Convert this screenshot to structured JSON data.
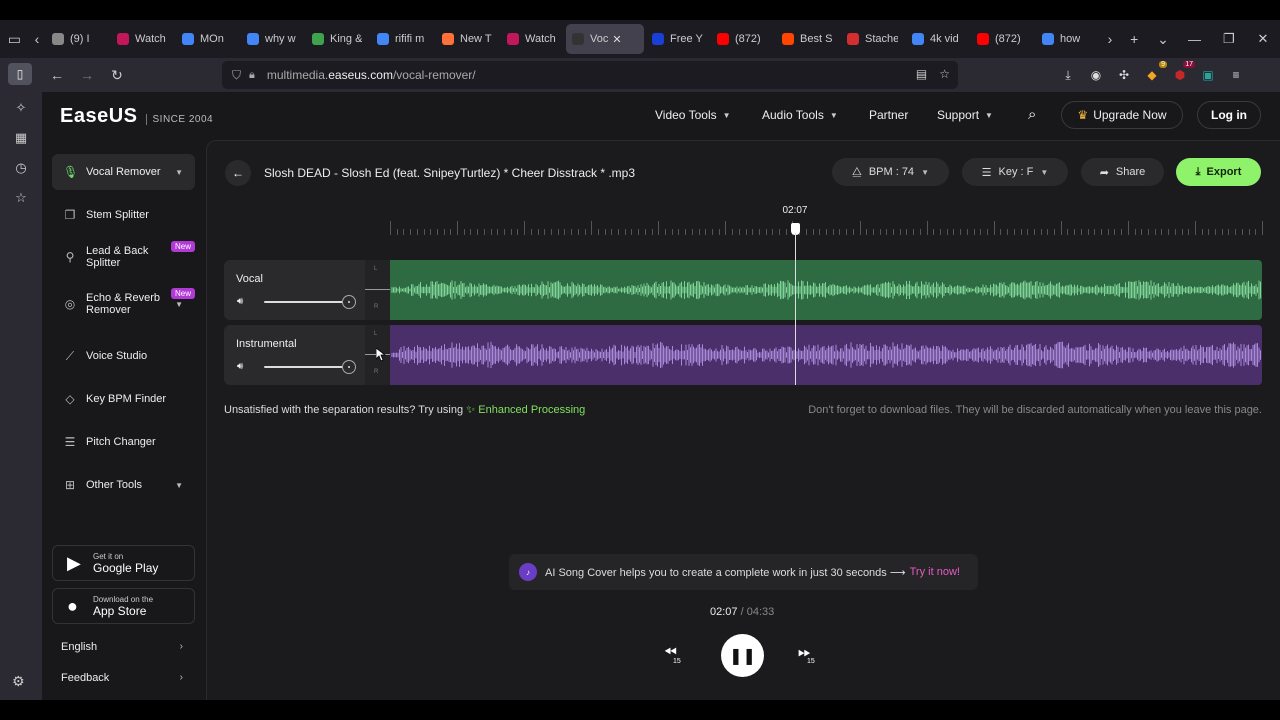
{
  "browser": {
    "tabs": [
      {
        "title": "(9) I",
        "favicon_color": "#888888",
        "icon": "generic-icon"
      },
      {
        "title": "Watch",
        "favicon_color": "#c2185b",
        "icon": "video-icon"
      },
      {
        "title": "MOn",
        "favicon_color": "#4285f4",
        "icon": "google-icon"
      },
      {
        "title": "why w",
        "favicon_color": "#4285f4",
        "icon": "google-icon"
      },
      {
        "title": "King &",
        "favicon_color": "#3fa34d",
        "icon": "leaf-icon"
      },
      {
        "title": "rififi m",
        "favicon_color": "#4285f4",
        "icon": "google-icon"
      },
      {
        "title": "New T",
        "favicon_color": "#ff7139",
        "icon": "firefox-icon"
      },
      {
        "title": "Watch",
        "favicon_color": "#c2185b",
        "icon": "video-icon"
      },
      {
        "title": "Voc",
        "favicon_color": "#333333",
        "icon": "audio-icon",
        "active": true
      },
      {
        "title": "Free Y",
        "favicon_color": "#1a3fd6",
        "icon": "triangle-icon"
      },
      {
        "title": "(872)",
        "favicon_color": "#ff0000",
        "icon": "youtube-icon"
      },
      {
        "title": "Best S",
        "favicon_color": "#ff4500",
        "icon": "reddit-icon"
      },
      {
        "title": "Stache",
        "favicon_color": "#d32f2f",
        "icon": "stache-icon"
      },
      {
        "title": "4k vid",
        "favicon_color": "#4285f4",
        "icon": "google-icon"
      },
      {
        "title": "(872)",
        "favicon_color": "#ff0000",
        "icon": "youtube-icon"
      },
      {
        "title": "how",
        "favicon_color": "#4285f4",
        "icon": "google-icon"
      }
    ],
    "url_prefix": "multimedia.",
    "url_domain": "easeus.com",
    "url_path": "/vocal-remover/",
    "ext_badge_1": "9",
    "ext_badge_2": "17"
  },
  "header": {
    "logo": "EaseUS",
    "since": "SINCE 2004",
    "nav": [
      "Video Tools",
      "Audio Tools",
      "Partner",
      "Support"
    ],
    "upgrade": "Upgrade Now",
    "login": "Log in"
  },
  "sidebar": {
    "tools": [
      {
        "label": "Vocal Remover",
        "icon": "mic-icon",
        "active": true,
        "chevron": true
      },
      {
        "label": "Stem Splitter",
        "icon": "layers-icon"
      },
      {
        "label": "Lead & Back Splitter",
        "icon": "mic-split-icon",
        "badge": "New"
      },
      {
        "label": "Echo & Reverb Remover",
        "icon": "echo-icon",
        "badge": "New",
        "chevron": true
      },
      {
        "label": "Voice Studio",
        "icon": "wand-icon"
      },
      {
        "label": "Key BPM Finder",
        "icon": "tag-icon"
      },
      {
        "label": "Pitch Changer",
        "icon": "sliders-icon"
      },
      {
        "label": "Other Tools",
        "icon": "grid-icon",
        "chevron": true
      }
    ],
    "google_play_small": "Get it on",
    "google_play_big": "Google Play",
    "app_store_small": "Download on the",
    "app_store_big": "App Store",
    "language": "English",
    "feedback": "Feedback"
  },
  "editor": {
    "file_title": "Slosh DEAD - Slosh Ed (feat. SnipeyTurtlez)  * Cheer Disstrack * .mp3",
    "bpm": "BPM : 74",
    "key": "Key : F",
    "share": "Share",
    "export": "Export",
    "playhead_time": "02:07",
    "tracks": [
      {
        "name": "Vocal",
        "color": "#2f6b42",
        "wave_color": "#7fd49a"
      },
      {
        "name": "Instrumental",
        "color": "#4a2f6b",
        "wave_color": "#a889d9"
      }
    ],
    "channel_l": "L",
    "channel_r": "R",
    "unsatisfied_text": "Unsatisfied with the separation results? Try using",
    "enhanced_link": "Enhanced Processing",
    "reminder": "Don't forget to download files. They will be discarded automatically when you leave this page.",
    "ai_banner_text": "AI Song Cover helps you to create a complete work in just 30 seconds ⟶",
    "ai_banner_link": "Try it now!",
    "current_time": "02:07",
    "total_time": "/ 04:33",
    "skip_seconds": "15",
    "playback_progress": 0.465
  }
}
